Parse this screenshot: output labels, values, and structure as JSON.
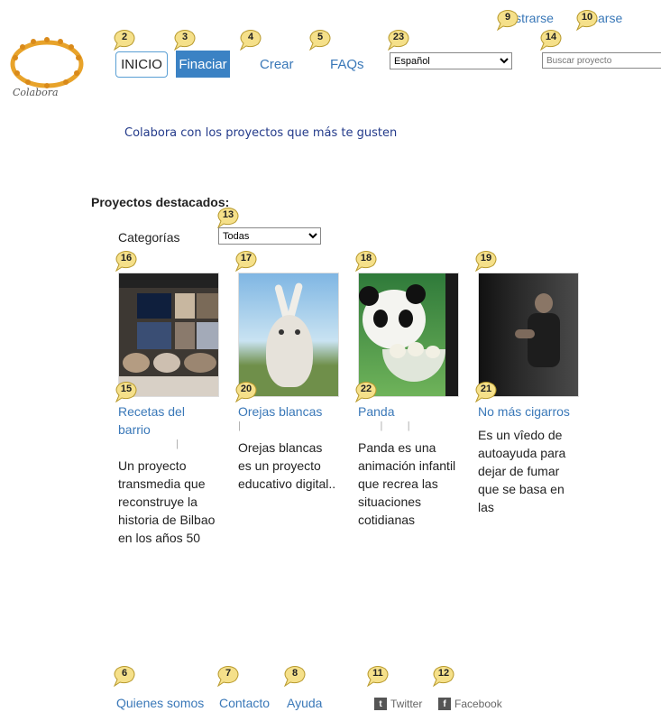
{
  "brand": {
    "name": "Colabora"
  },
  "nav": {
    "inicio": "INICIO",
    "financiar": "Finaciar",
    "crear": "Crear",
    "faqs": "FAQs"
  },
  "language": {
    "selected": "Español"
  },
  "search": {
    "placeholder": "Buscar proyecto"
  },
  "account": {
    "register": "istrarse",
    "login": "tificarse"
  },
  "tagline": "Colabora con los proyectos que más te gusten",
  "featured": {
    "title": "Proyectos destacados:",
    "category_label": "Categorías",
    "category_selected": "Todas",
    "projects": [
      {
        "title": "Recetas del barrio",
        "description": "Un proyecto transmedia que reconstruye la historia de Bilbao en los años 50"
      },
      {
        "title": "Orejas blancas",
        "description": "Orejas blancas es un proyecto educativo digital.."
      },
      {
        "title": "Panda",
        "description": "Panda es una animación infantil que recrea las situaciones cotidianas"
      },
      {
        "title": "No más cigarros",
        "description": "Es un vîedo de autoayuda para dejar de fumar que se basa en las"
      }
    ]
  },
  "footer": {
    "quienes": "Quienes somos",
    "contacto": "Contacto",
    "ayuda": "Ayuda",
    "twitter": "Twitter",
    "facebook": "Facebook"
  },
  "annotations": {
    "b2": "2",
    "b3": "3",
    "b4": "4",
    "b5": "5",
    "b23": "23",
    "b14": "14",
    "b9": "9",
    "b10": "10",
    "b13": "13",
    "b16": "16",
    "b17": "17",
    "b18": "18",
    "b19": "19",
    "b15": "15",
    "b20": "20",
    "b22": "22",
    "b21": "21",
    "b6": "6",
    "b7": "7",
    "b8": "8",
    "b11": "11",
    "b12": "12"
  },
  "colors": {
    "accent": "#3b82c4",
    "link": "#3a78b8",
    "badge": "#f5e08a"
  }
}
